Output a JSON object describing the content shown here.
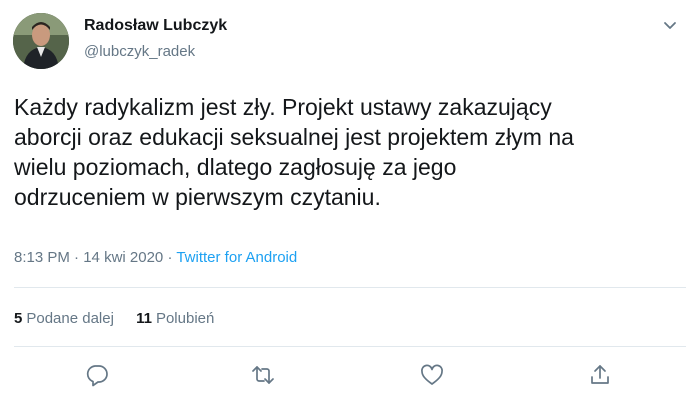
{
  "author": {
    "display_name": "Radosław Lubczyk",
    "handle": "@lubczyk_radek"
  },
  "tweet": {
    "text": "Każdy radykalizm jest zły. Projekt ustawy zakazujący\naborcji oraz edukacji seksualnej jest projektem złym na\nwielu poziomach, dlatego zagłosuję za jego\nodrzuceniem w pierwszym czytaniu."
  },
  "meta": {
    "time": "8:13 PM",
    "separator1": " · ",
    "date": "14 kwi 2020",
    "separator2": " · ",
    "source": "Twitter for Android"
  },
  "stats": {
    "retweets_count": "5",
    "retweets_label": "Podane dalej",
    "likes_count": "11",
    "likes_label": "Polubień"
  },
  "icons": {
    "caret": "chevron-down-icon",
    "reply": "reply-icon",
    "retweet": "retweet-icon",
    "like": "heart-icon",
    "share": "share-icon"
  },
  "colors": {
    "text": "#14171a",
    "secondary": "#657786",
    "link": "#1da1f2",
    "divider": "#e1e8ed"
  }
}
